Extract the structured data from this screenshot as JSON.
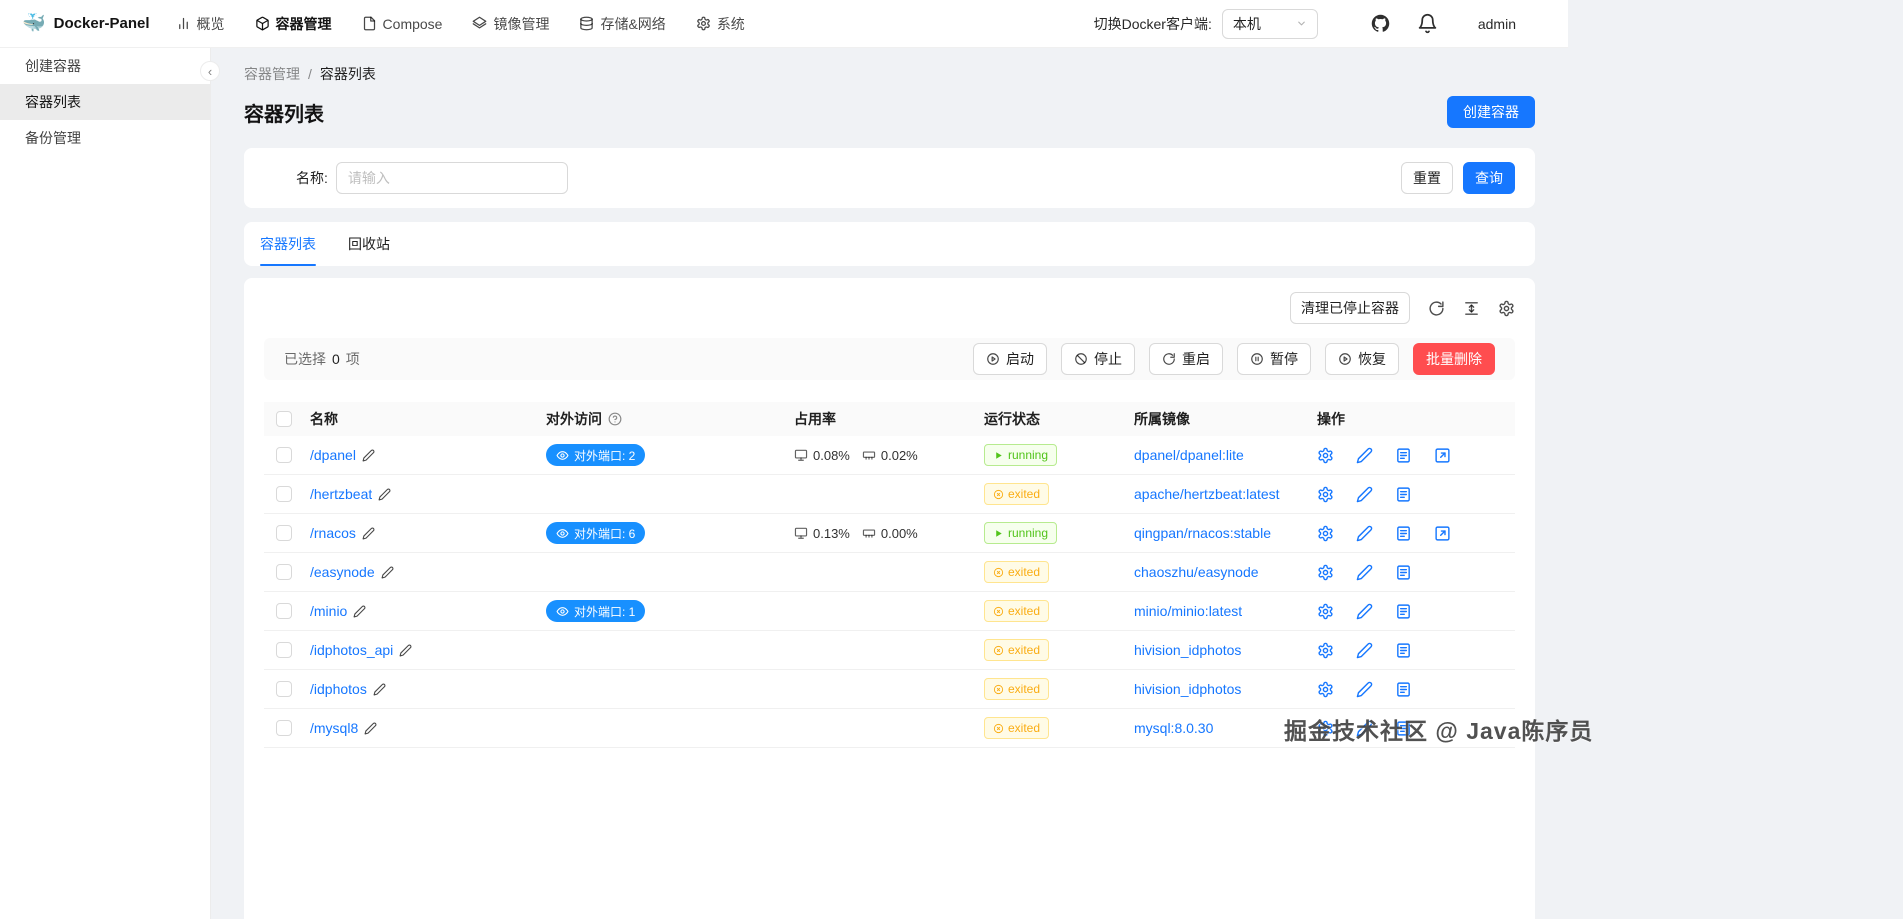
{
  "colors": {
    "primary": "#1677ff",
    "danger": "#ff4d4f",
    "running": "#52c41a",
    "exited": "#faad14",
    "port_badge": "#1890ff"
  },
  "header": {
    "brand": "Docker-Panel",
    "nav": [
      {
        "label": "概览",
        "icon": "bar-chart-icon"
      },
      {
        "label": "容器管理",
        "icon": "container-box-icon",
        "active": true
      },
      {
        "label": "Compose",
        "icon": "compose-file-icon"
      },
      {
        "label": "镜像管理",
        "icon": "layers-icon"
      },
      {
        "label": "存储&网络",
        "icon": "database-icon"
      },
      {
        "label": "系统",
        "icon": "gear-icon"
      }
    ],
    "client_switch_label": "切换Docker客户端:",
    "client_selected": "本机",
    "username": "admin"
  },
  "sidebar": {
    "items": [
      {
        "label": "创建容器"
      },
      {
        "label": "容器列表",
        "active": true
      },
      {
        "label": "备份管理"
      }
    ]
  },
  "breadcrumb": {
    "items": [
      "容器管理",
      "容器列表"
    ],
    "separator": "/"
  },
  "page": {
    "title": "容器列表",
    "create_button": "创建容器"
  },
  "filter": {
    "name_label": "名称:",
    "name_placeholder": "请输入",
    "reset_button": "重置",
    "query_button": "查询"
  },
  "tabs": [
    {
      "label": "容器列表",
      "active": true
    },
    {
      "label": "回收站"
    }
  ],
  "table_toolbar": {
    "clean_stopped_button": "清理已停止容器"
  },
  "selection_bar": {
    "prefix": "已选择",
    "count": "0",
    "suffix": "项",
    "actions": [
      {
        "label": "启动",
        "icon": "play-circle-icon"
      },
      {
        "label": "停止",
        "icon": "ban-icon"
      },
      {
        "label": "重启",
        "icon": "restart-icon"
      },
      {
        "label": "暂停",
        "icon": "pause-circle-icon"
      },
      {
        "label": "恢复",
        "icon": "resume-circle-icon"
      }
    ],
    "batch_delete_button": "批量删除"
  },
  "table": {
    "columns": [
      "名称",
      "对外访问",
      "占用率",
      "运行状态",
      "所属镜像",
      "操作"
    ],
    "rows": [
      {
        "name": "/dpanel",
        "ports": "对外端口: 2",
        "cpu": "0.08%",
        "mem": "0.02%",
        "status": "running",
        "image": "dpanel/dpanel:lite",
        "external": true
      },
      {
        "name": "/hertzbeat",
        "ports": "",
        "cpu": "",
        "mem": "",
        "status": "exited",
        "image": "apache/hertzbeat:latest",
        "external": false
      },
      {
        "name": "/rnacos",
        "ports": "对外端口: 6",
        "cpu": "0.13%",
        "mem": "0.00%",
        "status": "running",
        "image": "qingpan/rnacos:stable",
        "external": true
      },
      {
        "name": "/easynode",
        "ports": "",
        "cpu": "",
        "mem": "",
        "status": "exited",
        "image": "chaoszhu/easynode",
        "external": false
      },
      {
        "name": "/minio",
        "ports": "对外端口: 1",
        "cpu": "",
        "mem": "",
        "status": "exited",
        "image": "minio/minio:latest",
        "external": false
      },
      {
        "name": "/idphotos_api",
        "ports": "",
        "cpu": "",
        "mem": "",
        "status": "exited",
        "image": "hivision_idphotos",
        "external": false
      },
      {
        "name": "/idphotos",
        "ports": "",
        "cpu": "",
        "mem": "",
        "status": "exited",
        "image": "hivision_idphotos",
        "external": false
      },
      {
        "name": "/mysql8",
        "ports": "",
        "cpu": "",
        "mem": "",
        "status": "exited",
        "image": "mysql:8.0.30",
        "external": false
      }
    ]
  },
  "watermark": "掘金技术社区 @ Java陈序员"
}
